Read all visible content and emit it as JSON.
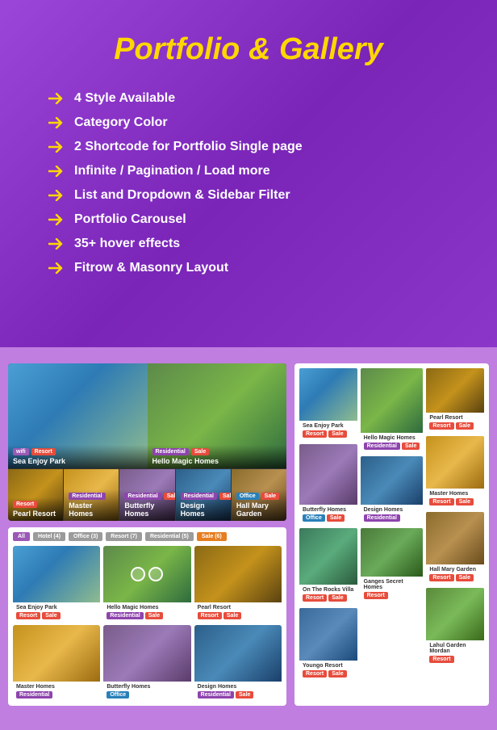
{
  "hero": {
    "title": "Portfolio & Gallery",
    "features": [
      "4 Style Available",
      "Category Color",
      "2 Shortcode for Portfolio Single page",
      "Infinite / Pagination / Load more",
      "List and Dropdown & Sidebar Filter",
      "Portfolio Carousel",
      "35+ hover effects",
      "Fitrow & Masonry Layout"
    ]
  },
  "carousel_preview": {
    "main_items": [
      {
        "name": "Sea Enjoy Park",
        "tags": [
          "wifi",
          "Resort"
        ],
        "img_class": "img-sea-enjoy"
      },
      {
        "name": "Hello Magic Homes",
        "tags": [
          "Residential",
          "Sale"
        ],
        "img_class": "img-magic-homes"
      }
    ],
    "thumb_items": [
      {
        "name": "Pearl Resort",
        "img_class": "img-pearl-resort"
      },
      {
        "name": "Master Homes",
        "img_class": "img-master-homes"
      },
      {
        "name": "Butterfly Homes",
        "img_class": "img-butterfly"
      },
      {
        "name": "Design Homes",
        "img_class": "img-design-homes"
      },
      {
        "name": "Hall Mary Garden",
        "img_class": "img-hall-mary"
      }
    ]
  },
  "filter_bar": {
    "items": [
      {
        "label": "All",
        "active": true
      },
      {
        "label": "Hotel (4)",
        "active": false
      },
      {
        "label": "Office (3)",
        "active": false
      },
      {
        "label": "Resort (7)",
        "active": false
      },
      {
        "label": "Residential (5)",
        "active": false
      },
      {
        "label": "Sale (6)",
        "active": false
      }
    ]
  },
  "grid_items": [
    {
      "name": "Sea Enjoy Park",
      "tags": [
        "Resort",
        "Sale"
      ],
      "img_class": "img-sea-enjoy"
    },
    {
      "name": "Hello Magic Homes",
      "tags": [
        "Residential",
        "Sale"
      ],
      "img_class": "img-magic-homes"
    },
    {
      "name": "Pearl Resort",
      "tags": [
        "Resort",
        "Sale"
      ],
      "img_class": "img-pearl-resort"
    },
    {
      "name": "Master Homes",
      "tags": [
        "Residential"
      ],
      "img_class": "img-master-homes"
    },
    {
      "name": "Butterfly Homes",
      "tags": [
        "Office"
      ],
      "img_class": "img-butterfly"
    },
    {
      "name": "Design Homes",
      "tags": [
        "Residential",
        "Sale"
      ],
      "img_class": "img-design-homes"
    }
  ],
  "masonry_items": [
    {
      "name": "Sea Enjoy Park",
      "tags": [
        "Resort",
        "Sale"
      ],
      "img_class": "img-sea-enjoy",
      "height": 70
    },
    {
      "name": "Hello Magic Homes",
      "tags": [
        "Residential",
        "Sale"
      ],
      "img_class": "img-magic-homes",
      "height": 90
    },
    {
      "name": "Pearl Resort",
      "tags": [
        "Resort",
        "Sale"
      ],
      "img_class": "img-pearl-resort",
      "height": 55
    },
    {
      "name": "Master Homes",
      "tags": [
        "Resort",
        "Sale"
      ],
      "img_class": "img-master-homes",
      "height": 65
    },
    {
      "name": "Butterfly Homes",
      "tags": [
        "Office",
        "Sale"
      ],
      "img_class": "img-butterfly",
      "height": 75
    },
    {
      "name": "Design Homes",
      "tags": [
        "Residential"
      ],
      "img_class": "img-design-homes",
      "height": 60
    },
    {
      "name": "Hall Mary Garden",
      "tags": [
        "Resort",
        "Sale"
      ],
      "img_class": "img-hall-mary",
      "height": 65
    },
    {
      "name": "On The Rocks Villa",
      "tags": [
        "Resort",
        "Sale"
      ],
      "img_class": "img-rocks-villa",
      "height": 70
    },
    {
      "name": "Ganges Secret Homes",
      "tags": [
        "Resort"
      ],
      "img_class": "img-ganges",
      "height": 60
    },
    {
      "name": "Lahul Garden Mordan",
      "tags": [
        "Resort"
      ],
      "img_class": "img-lahul",
      "height": 70
    },
    {
      "name": "Youngo Resort",
      "tags": [
        "Resort",
        "Sale"
      ],
      "img_class": "img-youngo",
      "height": 65
    }
  ],
  "tags": {
    "wifi": {
      "label": "wifi",
      "color": "#9b59b6"
    },
    "Resort": {
      "label": "Resort",
      "color": "#e74c3c"
    },
    "Residential": {
      "label": "Residential",
      "color": "#8e44ad"
    },
    "Sale": {
      "label": "Sale",
      "color": "#e74c3c"
    },
    "Office": {
      "label": "Office",
      "color": "#2980b9"
    }
  }
}
